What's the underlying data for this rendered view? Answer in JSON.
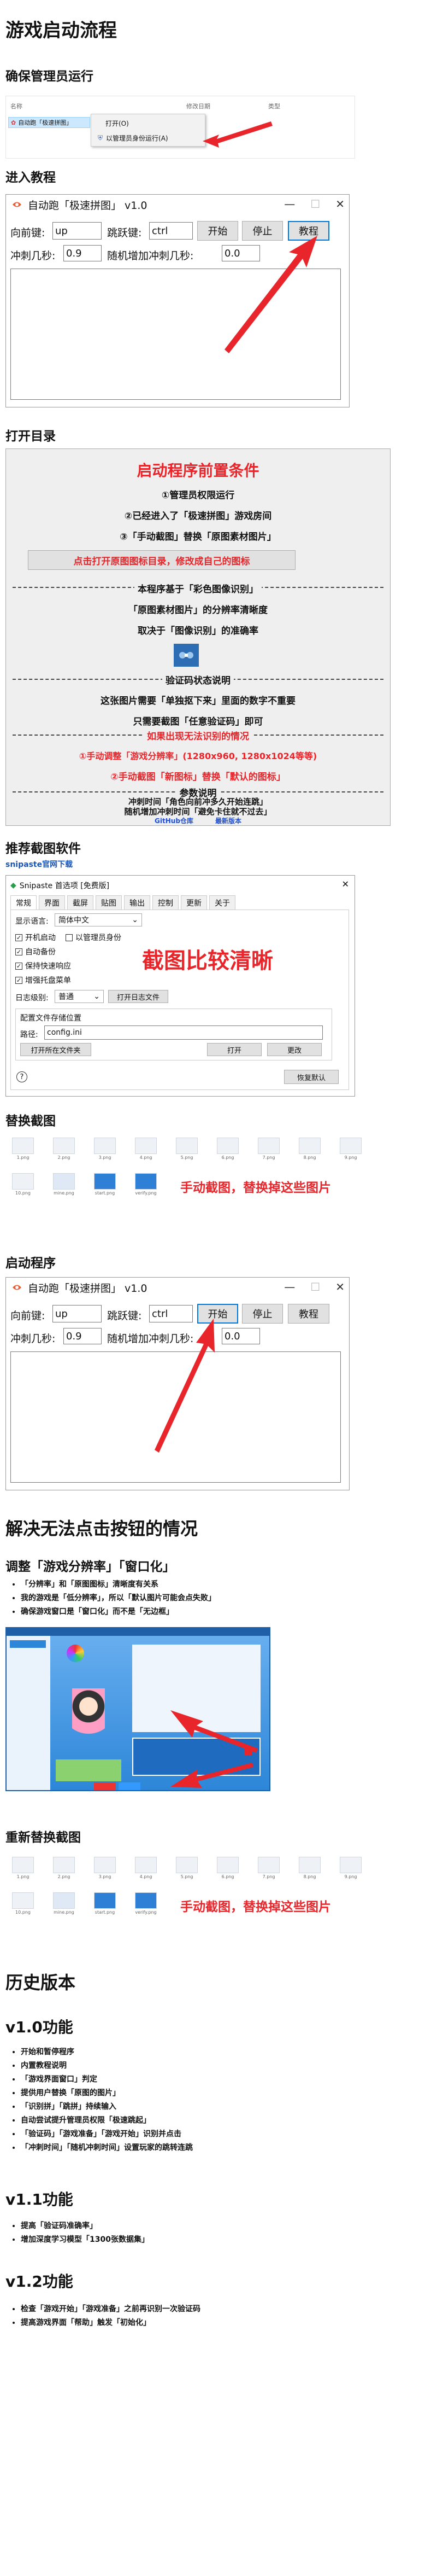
{
  "title": "游戏启动流程",
  "sections": {
    "admin": "确保管理员运行",
    "tutorial": "进入教程",
    "open_dir": "打开目录",
    "snipaste_title": "推荐截图软件",
    "snipaste_link": "snipaste官网下载",
    "replace": "替换截图",
    "start": "启动程序",
    "fix_click": "解决无法点击按钮的情况",
    "adjust": "调整「游戏分辨率」「窗口化」",
    "replace2": "重新替换截图",
    "history": "历史版本",
    "v10": "v1.0功能",
    "v11": "v1.1功能",
    "v12": "v1.2功能"
  },
  "explorer": {
    "col_name": "名称",
    "col_date": "修改日期",
    "col_type": "类型",
    "file_label": "自动跑「极速拼图」",
    "menu_open": "打开(O)",
    "menu_admin": "以管理员身份运行(A)"
  },
  "app": {
    "title": "自动跑「极速拼图」 v1.0",
    "min": "—",
    "max": "☐",
    "close": "✕",
    "label_forward": "向前键:",
    "val_forward": "up",
    "label_jump": "跳跃键:",
    "val_jump": "ctrl",
    "btn_start": "开始",
    "btn_stop": "停止",
    "btn_tutorial": "教程",
    "label_sprint": "冲刺几秒:",
    "val_sprint": "0.9",
    "label_random": "随机增加冲刺几秒:",
    "val_random": "0.0"
  },
  "guide": {
    "heading": "启动程序前置条件",
    "l1": "①管理员权限运行",
    "l2": "②已经进入了「极速拼图」游戏房间",
    "l3": "③「手动截图」替换「原图素材图片」",
    "open_btn": "点击打开原图图标目录，修改成自己的图标",
    "sec_prin": "本程序基于「彩色图像识别」",
    "p1": "「原图素材图片」的分辨率清晰度",
    "p2": "取决于「图像识别」的准确率",
    "sec_verify": "验证码状态说明",
    "v1": "这张图片需要「单独抠下来」里面的数字不重要",
    "v2": "只需要截图「任意验证码」即可",
    "sec_fail": "如果出现无法识别的情况",
    "f1": "①手动调整「游戏分辨率」(1280x960, 1280x1024等等)",
    "f2": "②手动截图「新图标」替换「默认的图标」",
    "sec_param": "参数说明",
    "q1": "冲刺时间「角色向前冲多久开始连跳」",
    "q2": "随机增加冲刺时间「避免卡住就不过去」",
    "link_github": "GitHub仓库",
    "link_latest": "最新版本"
  },
  "snipaste": {
    "title": "Snipaste 首选项 [免费版]",
    "tabs": [
      "常规",
      "界面",
      "截屏",
      "贴图",
      "输出",
      "控制",
      "更新",
      "关于"
    ],
    "lang_label": "显示语言:",
    "lang_val": "简体中文",
    "cb_boot": "开机启动",
    "cb_admin": "以管理员身份",
    "cb_backup": "自动备份",
    "cb_keep": "保持快速响应",
    "cb_tray": "增强托盘菜单",
    "log_label": "日志级别:",
    "log_val": "普通",
    "log_btn": "打开日志文件",
    "cfg_group": "配置文件存储位置",
    "path_label": "路径:",
    "path_val": "config.ini",
    "btn_open_folder": "打开所在文件夹",
    "btn_open": "打开",
    "btn_change": "更改",
    "btn_reset": "恢复默认",
    "help": "?",
    "overlay": "截图比较清晰"
  },
  "thumbs_row1": [
    "1.png",
    "2.png",
    "3.png",
    "4.png",
    "5.png",
    "6.png",
    "7.png",
    "8.png",
    "9.png"
  ],
  "thumbs_row2": [
    "10.png",
    "mine.png",
    "start.png",
    "verify.png"
  ],
  "replace_note": "手动截图，替换掉这些图片",
  "adjust_list": [
    "「分辨率」和「原图图标」清晰度有关系",
    "我的游戏是「低分辨率」，所以「默认图片可能会点失败」",
    "确保游戏窗口是「窗口化」而不是「无边框」"
  ],
  "v10_list": [
    "开始和暂停程序",
    "内置教程说明",
    "「游戏界面窗口」判定",
    "提供用户替换「原图的图片」",
    "「识别拼」「跳拼」持续输入",
    "自动尝试提升管理员权限「极速跳起」",
    "「验证码」「游戏准备」「游戏开始」识别并点击",
    "「冲刺时间」「随机冲刺时间」设置玩家的跳转连跳"
  ],
  "v11_list": [
    "提高「验证码准确率」",
    "增加深度学习模型「1300张数据集」"
  ],
  "v12_list": [
    "检查「游戏开始」「游戏准备」之前再识别一次验证码",
    "提高游戏界面「帮助」触发「初始化」"
  ],
  "colors": {
    "red": "#e8252a",
    "blue": "#1c4fd8",
    "focus": "#0078d7"
  }
}
